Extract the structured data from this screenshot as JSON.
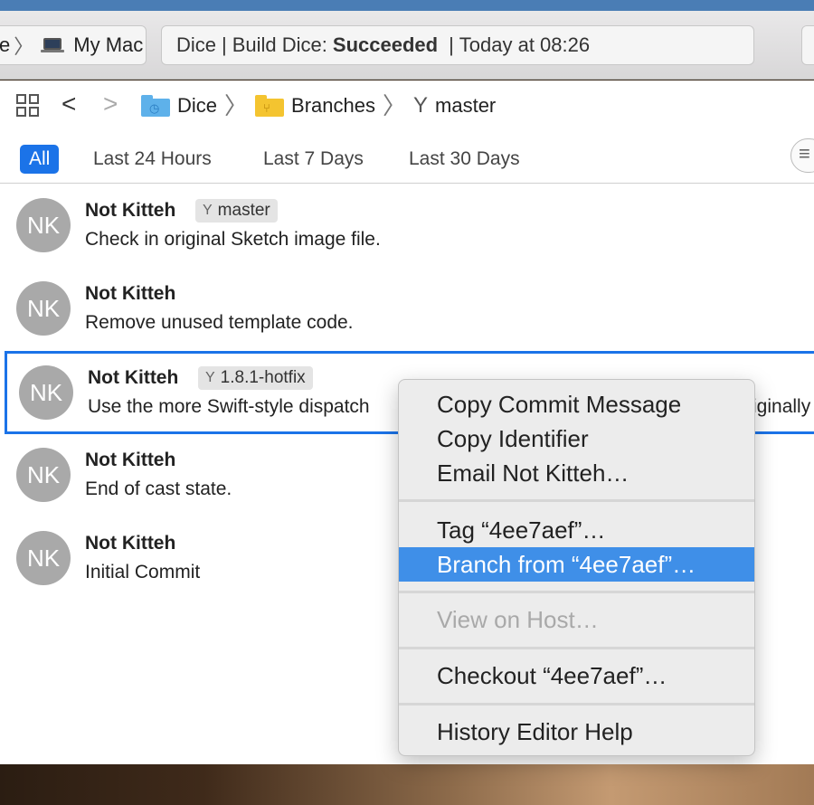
{
  "toolbar": {
    "scheme_prev": "e",
    "destination": "My Mac",
    "status": {
      "project": "Dice",
      "action": "Build Dice:",
      "result": "Succeeded",
      "time": "Today at 08:26"
    }
  },
  "jumpbar": {
    "crumbs": [
      "Dice",
      "Branches",
      "master"
    ]
  },
  "filters": {
    "options": [
      "All",
      "Last 24 Hours",
      "Last 7 Days",
      "Last 30 Days"
    ],
    "selected": "All"
  },
  "commits": [
    {
      "initials": "NK",
      "author": "Not Kitteh",
      "branch": "master",
      "message": "Check in original Sketch image file."
    },
    {
      "initials": "NK",
      "author": "Not Kitteh",
      "branch": null,
      "message": "Remove unused template code."
    },
    {
      "initials": "NK",
      "author": "Not Kitteh",
      "branch": "1.8.1-hotfix",
      "message": "Use the more Swift-style dispatch",
      "message_tail": "iginally",
      "selected": true
    },
    {
      "initials": "NK",
      "author": "Not Kitteh",
      "branch": null,
      "message": "End of cast state."
    },
    {
      "initials": "NK",
      "author": "Not Kitteh",
      "branch": null,
      "message": "Initial Commit"
    }
  ],
  "context_menu": {
    "items": [
      {
        "label": "Copy Commit Message"
      },
      {
        "label": "Copy Identifier"
      },
      {
        "label": "Email Not Kitteh…"
      },
      {
        "label": "Tag “4ee7aef”…"
      },
      {
        "label": "Branch from “4ee7aef”…",
        "highlighted": true
      },
      {
        "label": "View on Host…",
        "disabled": true
      },
      {
        "label": "Checkout “4ee7aef”…"
      },
      {
        "label": "History Editor Help"
      }
    ]
  },
  "colors": {
    "accent": "#1b73e8",
    "menu_highlight": "#3f8fe8",
    "avatar": "#a9a9a9"
  }
}
